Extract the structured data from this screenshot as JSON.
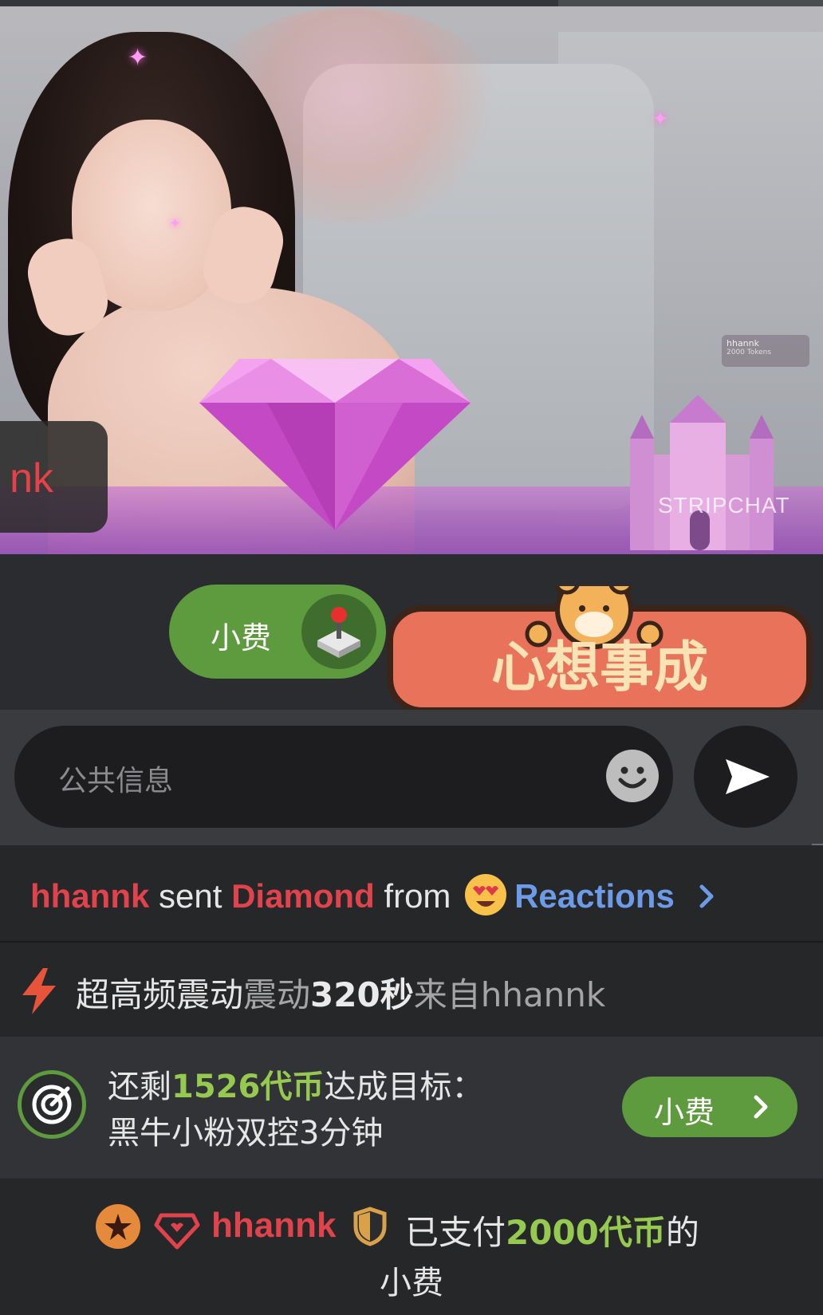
{
  "video": {
    "overlay_username": "nk",
    "watermark": "STRIPCHAT",
    "mini_notification": "hhannk",
    "mini_notification_sub": "2000 Tokens"
  },
  "tip_row": {
    "tip_label": "小费",
    "sticker_text": "心想事成"
  },
  "input": {
    "placeholder": "公共信息"
  },
  "messages": {
    "reaction": {
      "user": "hhannk",
      "sent": " sent ",
      "item": "Diamond",
      "from": " from ",
      "source": "Reactions"
    },
    "vibration": {
      "prefix": "超高频震动",
      "mid": "震动",
      "duration": "320秒",
      "from": "来自hhannk"
    },
    "goal": {
      "line1_prefix": "还剩",
      "amount": "1526代币",
      "line1_suffix": "达成目标：",
      "line2": "黑牛小粉双控3分钟",
      "button_label": "小费"
    },
    "tip": {
      "user": "hhannk",
      "paid_prefix": " 已支付",
      "amount": "2000代币",
      "paid_suffix": "的",
      "line2": "小费"
    }
  },
  "colors": {
    "accent_green": "#5e9a3e",
    "username_red": "#e0434b",
    "link_blue": "#6e9be8",
    "amount_green": "#95c94f"
  }
}
